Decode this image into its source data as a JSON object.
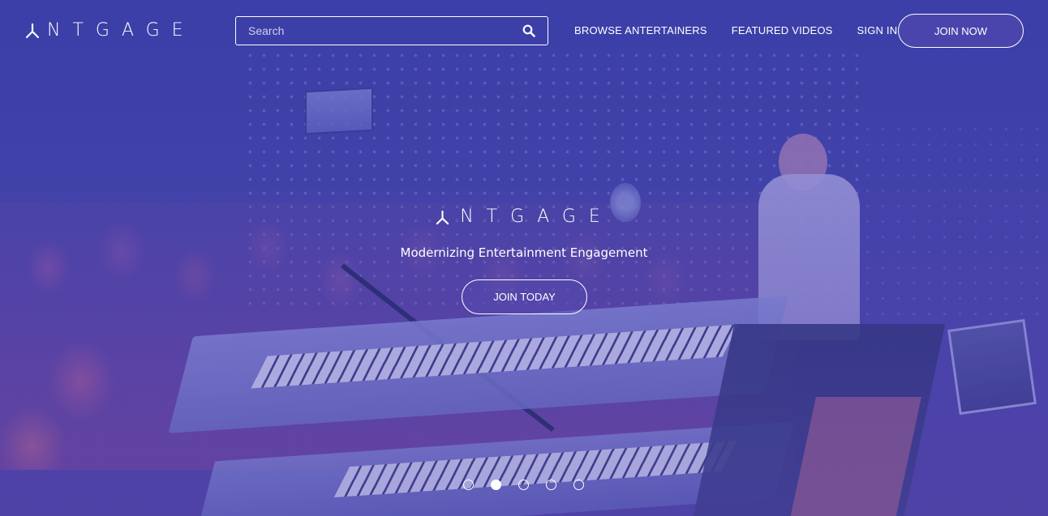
{
  "brand": {
    "name": "NTGAGE",
    "logo_icon": "tripod-a-logo-icon"
  },
  "search": {
    "placeholder": "Search",
    "value": "",
    "icon": "search-icon"
  },
  "nav": {
    "items": [
      {
        "label": "BROWSE ANTERTAINERS"
      },
      {
        "label": "FEATURED VIDEOS"
      },
      {
        "label": "SIGN IN"
      }
    ],
    "join_label": "JOIN NOW"
  },
  "hero": {
    "brand_name": "NTGAGE",
    "tagline": "Modernizing Entertainment Engagement",
    "cta_label": "JOIN TODAY",
    "carousel": {
      "count": 5,
      "active_index": 1
    }
  },
  "colors": {
    "overlay": "#4144aa",
    "text": "#ffffff"
  }
}
